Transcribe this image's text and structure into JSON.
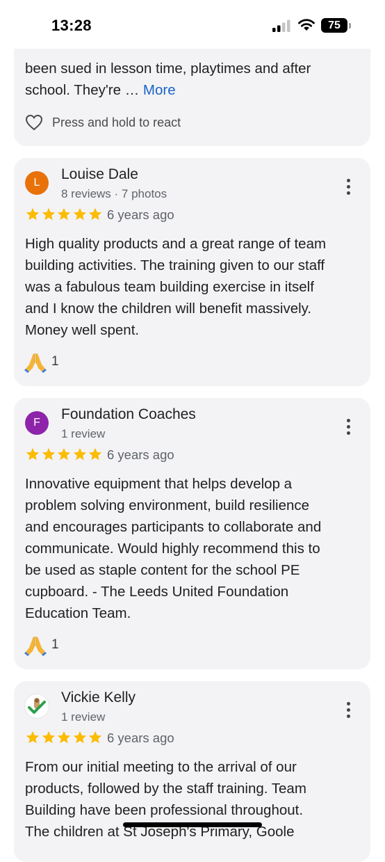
{
  "status_bar": {
    "time": "13:28",
    "battery": "75"
  },
  "top_card": {
    "text_lines": [
      "been sued in lesson time, playtimes and after",
      "school. They're … "
    ],
    "more_label": "More",
    "react_label": "Press and hold to react"
  },
  "reviews": [
    {
      "avatar_letter": "L",
      "avatar_color": "#e8710a",
      "name": "Louise Dale",
      "meta": "8 reviews · 7 photos",
      "rating": 5,
      "age": "6 years ago",
      "lines": [
        "High quality products and a great range of team",
        "building activities. The training given to our staff",
        "was a fabulous team building exercise in itself",
        "and I know the children will benefit massively.",
        "Money well spent."
      ],
      "reaction_count": "1"
    },
    {
      "avatar_letter": "F",
      "avatar_color": "#8e24aa",
      "name": "Foundation Coaches",
      "meta": "1 review",
      "rating": 5,
      "age": "6 years ago",
      "lines": [
        "Innovative equipment that helps develop a",
        "problem solving environment, build resilience",
        "and encourages participants to collaborate and",
        "communicate. Would highly recommend this to",
        "be used as staple content for the school PE",
        "cupboard. - The Leeds United Foundation",
        "Education Team."
      ],
      "reaction_count": "1"
    },
    {
      "avatar_letter": "",
      "name": "Vickie Kelly",
      "meta": "1 review",
      "rating": 5,
      "age": "6 years ago",
      "lines": [
        "From our initial meeting to the arrival of our",
        "products, followed by the staff training. Team",
        "Building have been professional throughout.",
        "The children at St Joseph's Primary, Goole"
      ]
    }
  ],
  "colors": {
    "star": "#fbbc04",
    "link": "#1a63c9",
    "card_bg": "#f3f3f6"
  },
  "icons": {
    "reaction": "folded-hands-icon",
    "react": "heart-outline-icon",
    "more": "more-vert-icon"
  }
}
